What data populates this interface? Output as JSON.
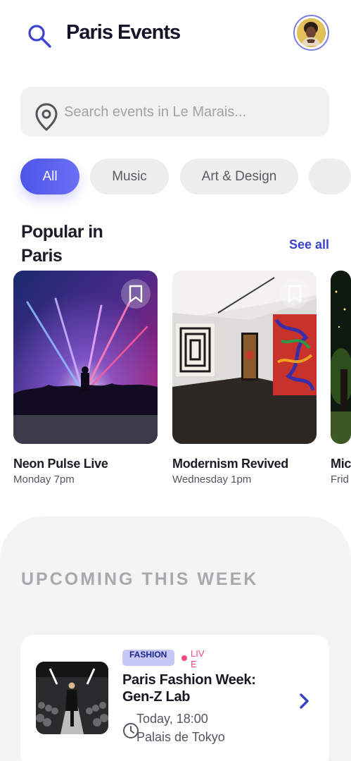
{
  "header": {
    "title": "Paris Events"
  },
  "search": {
    "placeholder": "Search events in Le Marais..."
  },
  "filters": [
    {
      "label": "All",
      "active": true
    },
    {
      "label": "Music",
      "active": false
    },
    {
      "label": "Art & Design",
      "active": false
    },
    {
      "label": "",
      "active": false
    }
  ],
  "popular": {
    "title": "Popular in Paris",
    "see_all": "See all",
    "cards": [
      {
        "title": "Neon Pulse Live",
        "time": "Monday 7pm"
      },
      {
        "title": "Modernism Revived",
        "time": "Wednesday 1pm"
      },
      {
        "title": "Mic",
        "time": "Frid"
      }
    ]
  },
  "upcoming": {
    "title": "UPCOMING THIS WEEK",
    "events": [
      {
        "tag": "FASHION",
        "status": "LIVE",
        "title": "Paris Fashion Week: Gen-Z Lab",
        "time": "Today, 18:00",
        "venue": "Palais de Tokyo"
      }
    ]
  },
  "colors": {
    "accent": "#4d55e8",
    "live": "#ef4a82",
    "link": "#3a43cf"
  },
  "icons": [
    "search-icon",
    "map-pin-icon",
    "bookmark-icon",
    "clock-icon",
    "chevron-right-icon"
  ]
}
